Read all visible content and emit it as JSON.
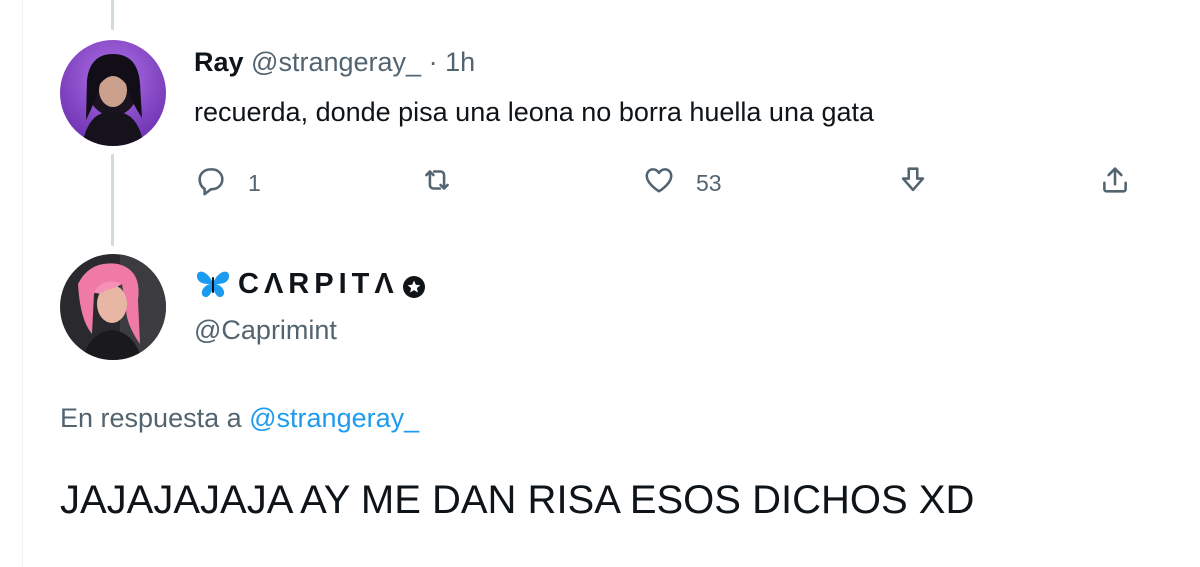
{
  "tweet1": {
    "name": "Ray",
    "handle": "@strangeray_",
    "separator": "·",
    "time": "1h",
    "text": "recuerda, donde pisa una leona no borra huella una gata",
    "actions": {
      "reply_icon": "reply-icon",
      "reply_count": "1",
      "retweet_icon": "retweet-icon",
      "like_icon": "heart-icon",
      "like_count": "53",
      "download_icon": "download-icon",
      "share_icon": "share-icon"
    }
  },
  "tweet2": {
    "name": "CΛRPITΛ",
    "name_icon": "butterfly-icon",
    "badge_icon": "star-badge-icon",
    "handle": "@Caprimint",
    "reply_prefix": "En respuesta a",
    "reply_mention": "@strangeray_",
    "text": "JAJAJAJAJA AY ME DAN RISA ESOS DICHOS XD"
  },
  "colors": {
    "text_primary": "#0f1419",
    "text_secondary": "#536471",
    "link": "#1d9bf0",
    "thread_line": "#cfd9de",
    "butterfly": "#1d9bf0"
  }
}
